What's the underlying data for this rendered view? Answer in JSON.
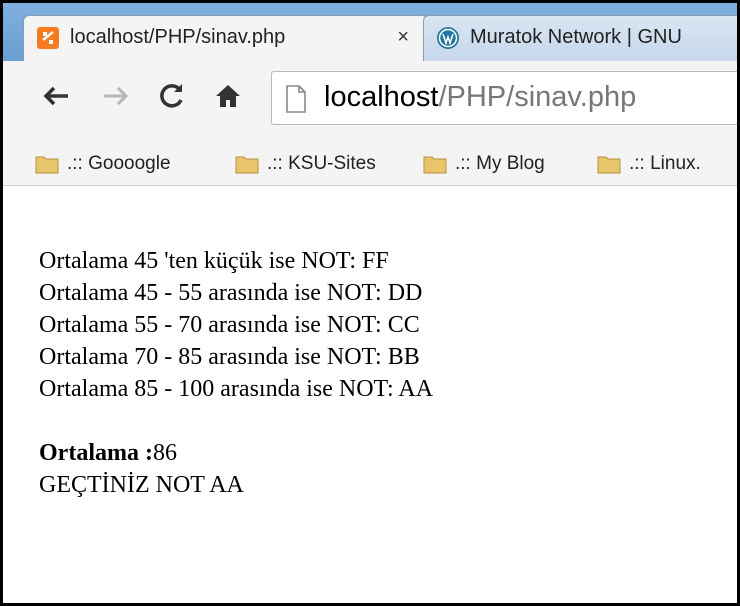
{
  "browser": {
    "tabs": [
      {
        "title": "localhost/PHP/sinav.php",
        "close": "×",
        "active": true
      },
      {
        "title": "Muratok Network | GNU",
        "active": false
      }
    ],
    "toolbar": {
      "back": "←",
      "forward": "→",
      "reload": "C",
      "home": "home-icon"
    },
    "address": {
      "host": "localhost",
      "path": "/PHP/sinav.php"
    },
    "bookmarks": [
      {
        "label": ".:: Goooogle"
      },
      {
        "label": ".:: KSU-Sites"
      },
      {
        "label": ".:: My Blog"
      },
      {
        "label": ".:: Linux."
      }
    ]
  },
  "page": {
    "rules": [
      "Ortalama 45 'ten küçük ise NOT: FF",
      "Ortalama 45 - 55 arasında ise NOT: DD",
      "Ortalama 55 - 70 arasında ise NOT: CC",
      "Ortalama 70 - 85 arasında ise NOT: BB",
      "Ortalama 85 - 100 arasında ise NOT: AA"
    ],
    "result_label": "Ortalama :",
    "result_value": "86",
    "result_text": "GEÇTİNİZ NOT AA"
  },
  "colors": {
    "tabstrip": "#7fb0df",
    "toolbar": "#f4f4f4",
    "favicon_xampp": "#f47b20",
    "favicon_wp": "#21759b",
    "folder": "#e8c56a"
  }
}
